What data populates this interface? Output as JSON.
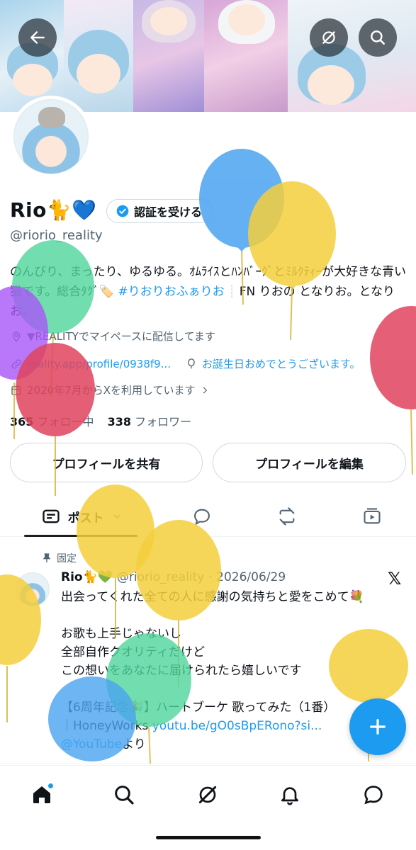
{
  "profile": {
    "name": "Rio🐈💙",
    "handle": "@riorio_reality",
    "verify_label": "認証を受ける",
    "bio_text": "のんびり、まったり、ゆるゆる。ｵﾑﾗｲｽとﾊﾝﾊﾞｰｸﾞとﾐﾙｸﾃｨｰが大好きな青い猫です。総合ﾀｸﾞ🏷️ ",
    "bio_hashtag": "#りおりおふぁりお",
    "bio_separator": "┊",
    "bio_tail": "FN りおの となりお。となりお。",
    "location": "▼REALITYでマイペースに配信してます",
    "website": "reality.app/profile/0938f9...",
    "birthday": "お誕生日おめでとうございます。",
    "joined": "2020年7月からXを利用しています",
    "following_count": "365",
    "following_label": "フォロー中",
    "followers_count": "338",
    "followers_label": "フォロワー"
  },
  "buttons": {
    "share": "プロフィールを共有",
    "edit": "プロフィールを編集"
  },
  "tabs": {
    "posts_label": "ポスト"
  },
  "post": {
    "pinned_label": "固定",
    "author_name": "Rio🐈💚",
    "author_handle": "@riorio_reality",
    "date": "· 2026/06/29",
    "x_logo": "𝕏",
    "body": "出会ってくれた全ての人に感謝の気持ちと愛をこめて💐\n\nお歌も上手じゃないし\n全部自作クオリティだけど\nこの想いをあなたに届けられたら嬉しいです\n\n【6周年記念🎉】ハートブーケ 歌ってみた（1番）\n｜HoneyWorks ",
    "body_link": "youtu.be/gO0sBpERono?si...",
    "body_after": "@YouTube",
    "body_end": "より"
  },
  "icons": {
    "back": "arrow-left-icon",
    "grok": "grok-icon",
    "search": "search-icon",
    "home": "home-icon",
    "notifications": "bell-icon",
    "messages": "chat-icon",
    "compose": "plus-icon"
  },
  "colors": {
    "accent": "#1d9bf0",
    "text": "#0f1419",
    "muted": "#536471",
    "balloon_blue": "#4aa3f0",
    "balloon_yellow": "#f4cf3c",
    "balloon_green": "#4fd69c",
    "balloon_red": "#e0445e",
    "balloon_purple": "#a855f7"
  }
}
